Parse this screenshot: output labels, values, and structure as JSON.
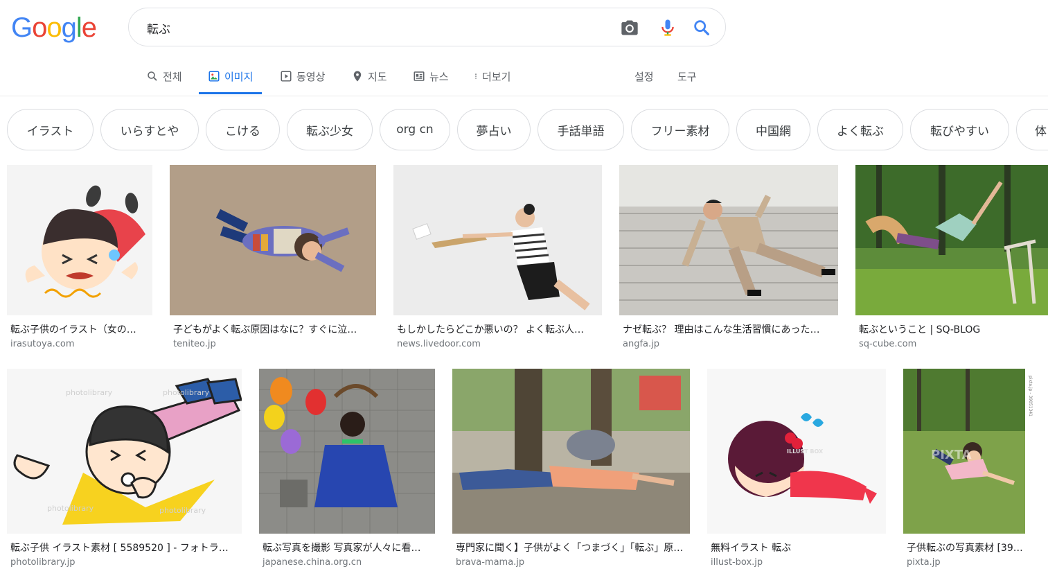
{
  "logo": {
    "letters": [
      "G",
      "o",
      "o",
      "g",
      "l",
      "e"
    ],
    "colors": [
      "#4285F4",
      "#EA4335",
      "#FBBC05",
      "#4285F4",
      "#34A853",
      "#EA4335"
    ]
  },
  "search": {
    "query": "転ぶ",
    "icons": [
      "camera-icon",
      "microphone-icon",
      "search-icon"
    ]
  },
  "tabs": [
    {
      "label": "전체",
      "icon": "search-icon",
      "active": false
    },
    {
      "label": "이미지",
      "icon": "image-icon",
      "active": true
    },
    {
      "label": "동영상",
      "icon": "video-icon",
      "active": false
    },
    {
      "label": "지도",
      "icon": "map-pin-icon",
      "active": false
    },
    {
      "label": "뉴스",
      "icon": "news-icon",
      "active": false
    },
    {
      "label": "더보기",
      "icon": "more-vert-icon",
      "active": false
    }
  ],
  "tools": {
    "settings": "설정",
    "tools": "도구"
  },
  "chips": [
    "イラスト",
    "いらすとや",
    "こける",
    "転ぶ少女",
    "org cn",
    "夢占い",
    "手話単語",
    "フリー素材",
    "中国網",
    "よく転ぶ",
    "転びやすい",
    "体"
  ],
  "results": [
    {
      "title": "転ぶ子供のイラスト（女の…",
      "source": "irasutoya.com"
    },
    {
      "title": "子どもがよく転ぶ原因はなに？すぐに泣…",
      "source": "teniteo.jp"
    },
    {
      "title": "もしかしたらどこか悪いの？ よく転ぶ人…",
      "source": "news.livedoor.com"
    },
    {
      "title": "ナゼ転ぶ？ 理由はこんな生活習慣にあった…",
      "source": "angfa.jp"
    },
    {
      "title": "転ぶということ | SQ-BLOG",
      "source": "sq-cube.com"
    },
    {
      "title": "転ぶ子供 イラスト素材 [ 5589520 ] - フォトラ…",
      "source": "photolibrary.jp"
    },
    {
      "title": "転ぶ写真を撮影 写真家が人々に看…",
      "source": "japanese.china.org.cn"
    },
    {
      "title": "専門家に聞く】子供がよく「つまづく」「転ぶ」原…",
      "source": "brava-mama.jp"
    },
    {
      "title": "無料イラスト 転ぶ",
      "source": "illust-box.jp"
    },
    {
      "title": "子供転ぶの写真素材 [39…",
      "source": "pixta.jp"
    }
  ],
  "watermarks": {
    "photolibrary": "photolibrary",
    "illustbox": "ILLUST BOX",
    "pixta": "PIXTA",
    "pixta_id": "pixta.jp - 39051341"
  }
}
